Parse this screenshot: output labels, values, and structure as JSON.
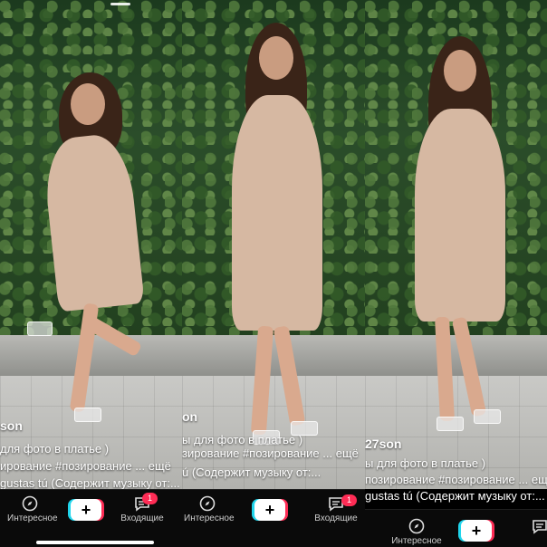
{
  "panels": [
    {
      "username": "son",
      "caption_line1": "для фото в платье )",
      "caption_line2": "ирование #позирование ... ещё",
      "music": "gustas tú (Содержит музыку от:..."
    },
    {
      "username": "on",
      "caption_line1": "ы для фото в платье )",
      "caption_line2": "зирование #позирование ... ещё",
      "music": "ú (Содержит музыку от:..."
    },
    {
      "username": "27son",
      "caption_line1": "ы для фото в платье )",
      "caption_line2": "позирование #позирование ... ещё",
      "music": "gustas tú (Содержит музыку от:..."
    }
  ],
  "nav": {
    "discover_label": "Интересное",
    "add_label": "+",
    "inbox_label": "Входящие",
    "inbox_badge": "1",
    "discover_icon": "compass-icon",
    "inbox_icon": "message-icon"
  },
  "colors": {
    "accent_red": "#fe2c55",
    "accent_cyan": "#20d5ec",
    "nav_background": "#0a0a0a"
  }
}
